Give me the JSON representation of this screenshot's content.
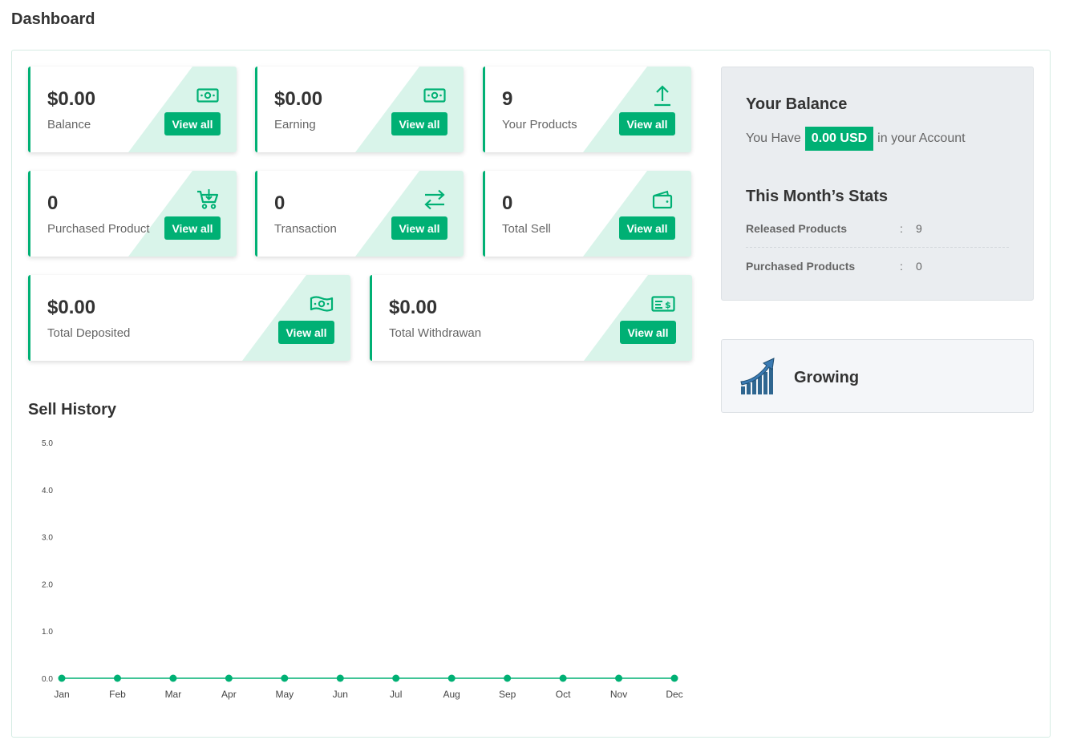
{
  "page": {
    "title": "Dashboard"
  },
  "cards": [
    {
      "value": "$0.00",
      "label": "Balance",
      "button": "View all",
      "icon": "money-bill-icon"
    },
    {
      "value": "$0.00",
      "label": "Earning",
      "button": "View all",
      "icon": "money-bill-icon"
    },
    {
      "value": "9",
      "label": "Your Products",
      "button": "View all",
      "icon": "upload-icon"
    },
    {
      "value": "0",
      "label": "Purchased Product",
      "button": "View all",
      "icon": "cart-icon"
    },
    {
      "value": "0",
      "label": "Transaction",
      "button": "View all",
      "icon": "exchange-icon"
    },
    {
      "value": "0",
      "label": "Total Sell",
      "button": "View all",
      "icon": "wallet-icon"
    },
    {
      "value": "$0.00",
      "label": "Total Deposited",
      "button": "View all",
      "icon": "money-wave-icon"
    },
    {
      "value": "$0.00",
      "label": "Total Withdrawan",
      "button": "View all",
      "icon": "money-check-icon"
    }
  ],
  "balance": {
    "title": "Your Balance",
    "prefix": "You Have",
    "amount": "0.00 USD",
    "suffix": "in your Account"
  },
  "month_stats": {
    "title": "This Month’s Stats",
    "rows": [
      {
        "label": "Released Products",
        "separator": ":",
        "value": "9"
      },
      {
        "label": "Purchased Products",
        "separator": ":",
        "value": "0"
      }
    ]
  },
  "growing": {
    "label": "Growing",
    "icon": "growth-chart-icon"
  },
  "sell_history": {
    "title": "Sell History"
  },
  "colors": {
    "accent": "#00b074",
    "accent_light": "#d9f4ea",
    "panel_gray": "#eaedf0",
    "growth_icon": "#2f6690"
  },
  "chart_data": {
    "type": "line",
    "title": "Sell History",
    "categories": [
      "Jan",
      "Feb",
      "Mar",
      "Apr",
      "May",
      "Jun",
      "Jul",
      "Aug",
      "Sep",
      "Oct",
      "Nov",
      "Dec"
    ],
    "values": [
      0,
      0,
      0,
      0,
      0,
      0,
      0,
      0,
      0,
      0,
      0,
      0
    ],
    "y_ticks": [
      "0.0",
      "1.0",
      "2.0",
      "3.0",
      "4.0",
      "5.0"
    ],
    "ylim": [
      0,
      5
    ],
    "grid": false,
    "line_color": "#00b074"
  }
}
